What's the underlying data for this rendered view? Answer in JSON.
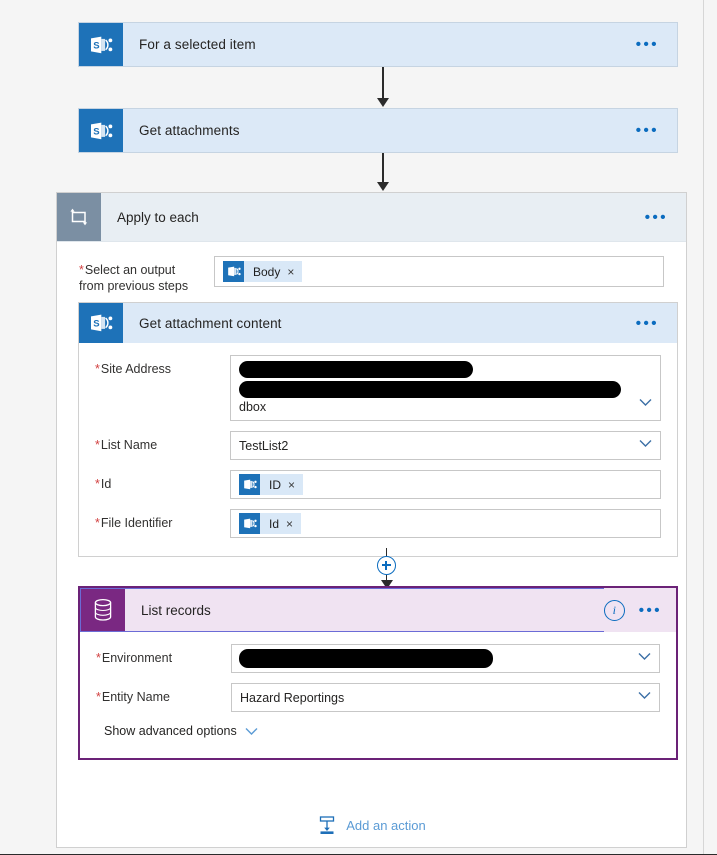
{
  "colors": {
    "canvas_bg": "#f5f5f5",
    "sharepoint_blue": "#1e72b8",
    "action_card_bg": "#dce9f7",
    "scope_header_bg": "#e8eef3",
    "scope_icon_bg": "#7b8fa3",
    "dataverse_purple": "#7a2882",
    "selected_card_border": "#6b2277",
    "selected_header_bg": "#f0e3f2",
    "selection_outline": "#6b6bd6",
    "link_blue": "#0b6cbf",
    "required_red": "#d23f3f",
    "redaction_black": "#000000"
  },
  "steps": {
    "trigger": {
      "title": "For a selected item",
      "icon": "sharepoint-icon",
      "menu": "•••"
    },
    "get_attachments": {
      "title": "Get attachments",
      "icon": "sharepoint-icon",
      "menu": "•••"
    },
    "apply_to_each": {
      "title": "Apply to each",
      "icon": "loop-icon",
      "menu": "•••",
      "select_output": {
        "label_line1": "Select an output",
        "label_line2": "from previous steps",
        "required": "*",
        "token": {
          "text": "Body",
          "icon": "sharepoint-icon",
          "remove": "×"
        }
      }
    },
    "get_attachment_content": {
      "title": "Get attachment content",
      "icon": "sharepoint-icon",
      "menu": "•••",
      "fields": [
        {
          "label": "Site Address",
          "required": "*",
          "type": "dropdown-redacted",
          "value": "dbox",
          "redacted_lines": 2
        },
        {
          "label": "List Name",
          "required": "*",
          "type": "dropdown",
          "value": "TestList2"
        },
        {
          "label": "Id",
          "required": "*",
          "type": "token",
          "token": {
            "text": "ID",
            "icon": "sharepoint-icon",
            "remove": "×"
          }
        },
        {
          "label": "File Identifier",
          "required": "*",
          "type": "token",
          "token": {
            "text": "Id",
            "icon": "sharepoint-icon",
            "remove": "×"
          }
        }
      ]
    },
    "list_records": {
      "title": "List records",
      "icon": "database-icon",
      "info": "i",
      "menu": "•••",
      "selected": true,
      "fields": [
        {
          "label": "Environment",
          "required": "*",
          "type": "dropdown-redacted",
          "value": "",
          "redacted_lines": 1
        },
        {
          "label": "Entity Name",
          "required": "*",
          "type": "dropdown",
          "value": "Hazard Reportings"
        }
      ],
      "advanced_options": {
        "label": "Show advanced options",
        "icon": "chevron-down-icon"
      }
    }
  },
  "footer": {
    "add_action": {
      "label": "Add an action",
      "icon": "insert-action-icon"
    }
  }
}
